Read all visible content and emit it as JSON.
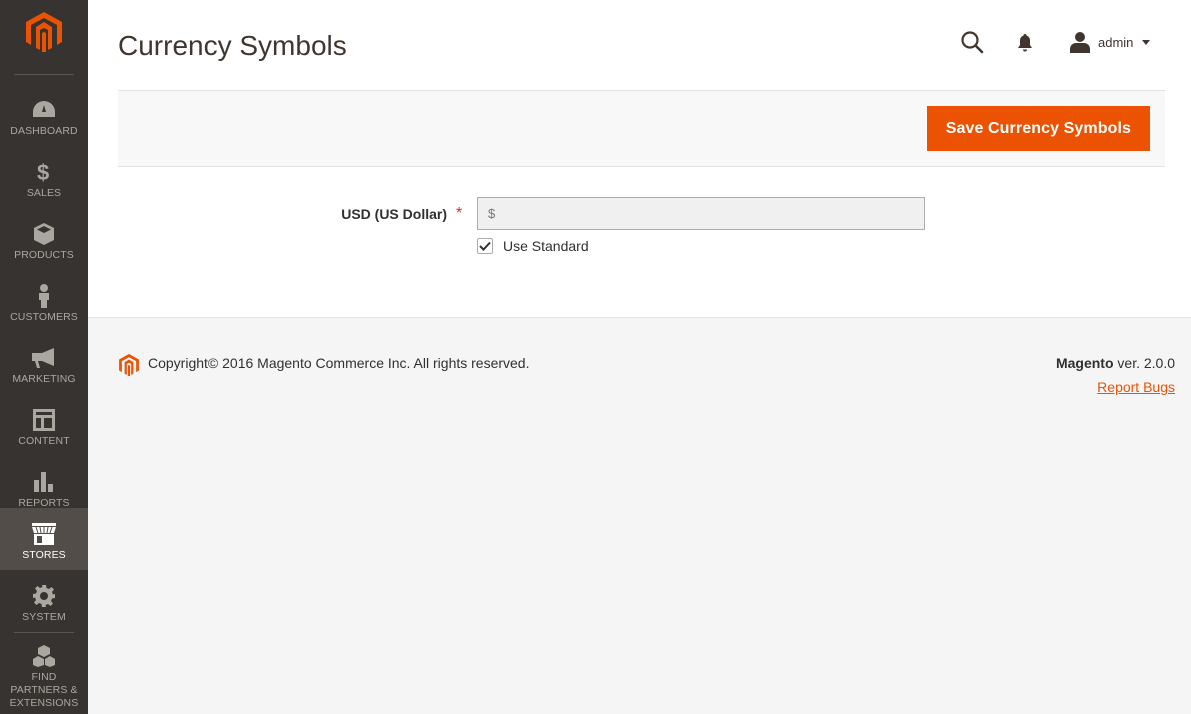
{
  "sidebar": {
    "items": [
      {
        "label": "Dashboard",
        "icon": "dashboard-icon"
      },
      {
        "label": "Sales",
        "icon": "dollar-icon"
      },
      {
        "label": "Products",
        "icon": "box-icon"
      },
      {
        "label": "Customers",
        "icon": "person-icon"
      },
      {
        "label": "Marketing",
        "icon": "megaphone-icon"
      },
      {
        "label": "Content",
        "icon": "layout-icon"
      },
      {
        "label": "Reports",
        "icon": "bar-chart-icon"
      },
      {
        "label": "Stores",
        "icon": "storefront-icon",
        "active": true
      },
      {
        "label": "System",
        "icon": "gear-icon"
      },
      {
        "label": "Find Partners & Extensions",
        "icon": "boxes-icon"
      }
    ]
  },
  "header": {
    "title": "Currency Symbols",
    "user": "admin"
  },
  "action_bar": {
    "save_label": "Save Currency Symbols"
  },
  "form": {
    "field_label": "USD (US Dollar)",
    "required_mark": "*",
    "symbol_placeholder": "$",
    "use_standard_label": "Use Standard",
    "use_standard_checked": true
  },
  "footer": {
    "copyright": "Copyright© 2016 Magento Commerce Inc. All rights reserved.",
    "brand": "Magento",
    "version": " ver. 2.0.0",
    "report_bugs": "Report Bugs"
  },
  "colors": {
    "accent": "#eb5202",
    "sidebar_bg": "#373330",
    "sidebar_active": "#524d49"
  }
}
